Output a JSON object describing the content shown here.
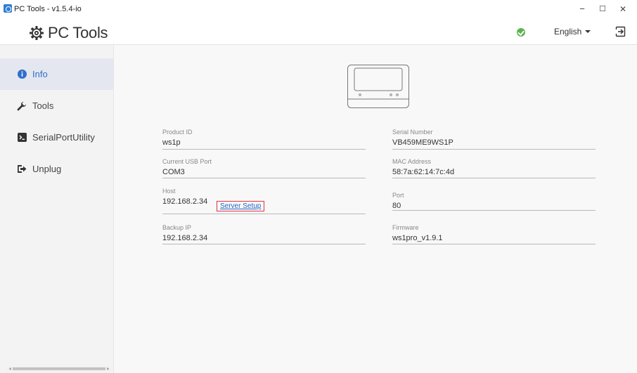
{
  "window": {
    "title": "PC Tools - v1.5.4-io",
    "controls": {
      "minimize": "−",
      "maximize": "☐",
      "close": "✕"
    }
  },
  "header": {
    "logo_text": "PC Tools",
    "language": "English"
  },
  "sidebar": {
    "items": [
      {
        "label": "Info",
        "icon": "info-icon",
        "active": true
      },
      {
        "label": "Tools",
        "icon": "wrench-icon",
        "active": false
      },
      {
        "label": "SerialPortUtility",
        "icon": "terminal-icon",
        "active": false
      },
      {
        "label": "Unplug",
        "icon": "unplug-icon",
        "active": false
      }
    ]
  },
  "info": {
    "product_id": {
      "label": "Product ID",
      "value": "ws1p"
    },
    "serial_number": {
      "label": "Serial Number",
      "value": "VB459ME9WS1P"
    },
    "usb_port": {
      "label": "Current USB Port",
      "value": "COM3"
    },
    "mac_address": {
      "label": "MAC Address",
      "value": "58:7a:62:14:7c:4d"
    },
    "host": {
      "label": "Host",
      "value": "192.168.2.34"
    },
    "server_setup": "Server Setup",
    "port": {
      "label": "Port",
      "value": "80"
    },
    "backup_ip": {
      "label": "Backup IP",
      "value": "192.168.2.34"
    },
    "firmware": {
      "label": "Firmware",
      "value": "ws1pro_v1.9.1"
    }
  },
  "colors": {
    "accent": "#2f6fc9",
    "status_ok": "#5bb450",
    "highlight_border": "#e0343a"
  }
}
